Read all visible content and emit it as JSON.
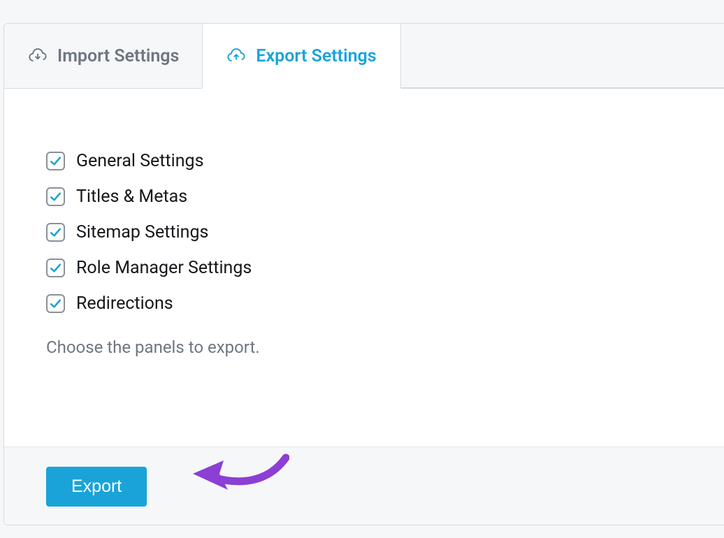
{
  "tabs": {
    "import": {
      "label": "Import Settings"
    },
    "export": {
      "label": "Export Settings"
    }
  },
  "options": [
    {
      "label": "General Settings",
      "checked": true
    },
    {
      "label": "Titles & Metas",
      "checked": true
    },
    {
      "label": "Sitemap Settings",
      "checked": true
    },
    {
      "label": "Role Manager Settings",
      "checked": true
    },
    {
      "label": "Redirections",
      "checked": true
    }
  ],
  "help_text": "Choose the panels to export.",
  "footer": {
    "export_label": "Export"
  },
  "colors": {
    "accent": "#1aa3d9",
    "arrow": "#8b3fd4"
  }
}
